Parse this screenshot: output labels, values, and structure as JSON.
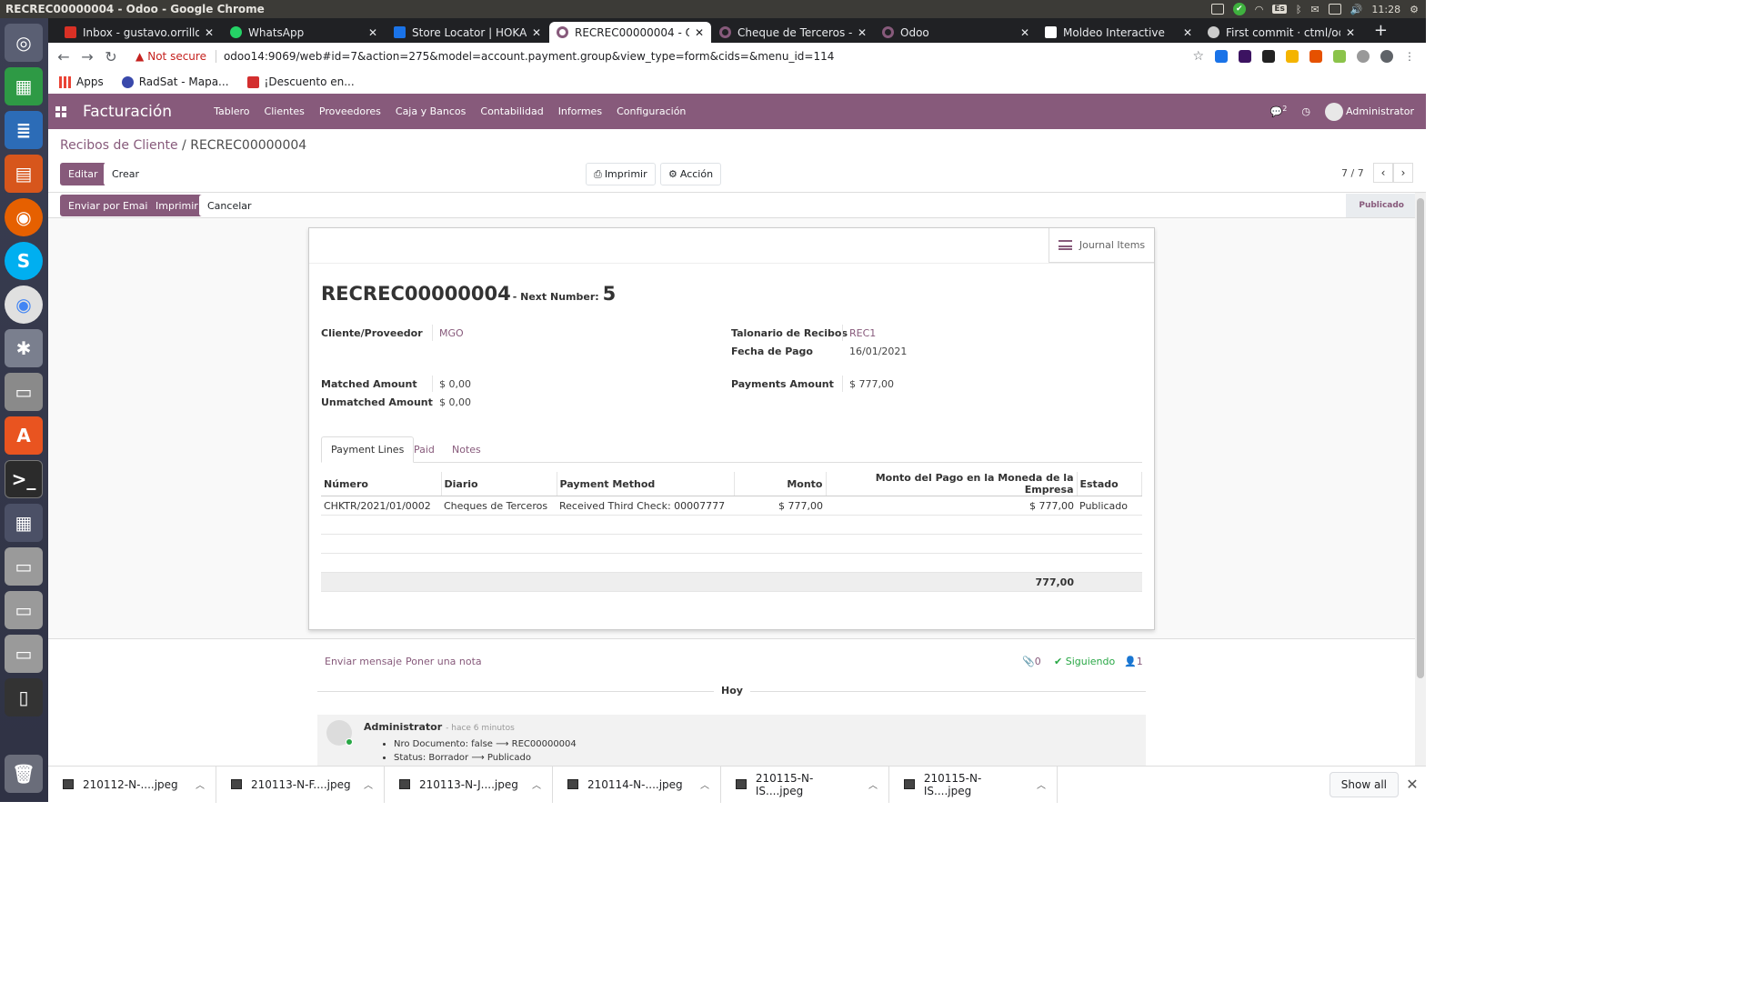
{
  "window_title": "RECREC00000004 - Odoo - Google Chrome",
  "system": {
    "lang": "Es",
    "time": "11:28"
  },
  "tabs": [
    {
      "label": "Inbox - gustavo.orrillo@",
      "icon_color": "#d93025"
    },
    {
      "label": "WhatsApp",
      "icon_color": "#25d366"
    },
    {
      "label": "Store Locator | HOKA O",
      "icon_color": "#1a73e8"
    },
    {
      "label": "RECREC00000004 - Odoo",
      "icon_color": "#875a7b"
    },
    {
      "label": "Cheque de Terceros - O",
      "icon_color": "#875a7b"
    },
    {
      "label": "Odoo",
      "icon_color": "#875a7b"
    },
    {
      "label": "Moldeo Interactive",
      "icon_color": "#ffffff"
    },
    {
      "label": "First commit · ctml/odo",
      "icon_color": "#cccccc"
    }
  ],
  "address": {
    "warning": "Not secure",
    "url": "odoo14:9069/web#id=7&action=275&model=account.payment.group&view_type=form&cids=&menu_id=114"
  },
  "bookmarks": [
    "Apps",
    "RadSat - Mapa...",
    "¡Descuento en..."
  ],
  "odoo": {
    "app": "Facturación",
    "menu": [
      "Tablero",
      "Clientes",
      "Proveedores",
      "Caja y Bancos",
      "Contabilidad",
      "Informes",
      "Configuración"
    ],
    "chat_count": "2",
    "user": "Administrator"
  },
  "breadcrumb": {
    "parent": "Recibos de Cliente",
    "sep": " / ",
    "current": "RECREC00000004"
  },
  "buttons": {
    "edit": "Editar",
    "create": "Crear",
    "print": "Imprimir",
    "action": "Acción",
    "send_email": "Enviar por Email",
    "print2": "Imprimir",
    "cancel": "Cancelar"
  },
  "pager": "7 / 7",
  "status": "Publicado",
  "form": {
    "journal_items": "Journal Items",
    "name": "RECREC00000004",
    "next_number_label": "- Next Number:",
    "next_number": "5",
    "partner_label": "Cliente/Proveedor",
    "partner": "MGO",
    "receiptbook_label": "Talonario de Recibos",
    "receiptbook": "REC1",
    "date_label": "Fecha de Pago",
    "date": "16/01/2021",
    "matched_label": "Matched Amount",
    "matched": "$ 0,00",
    "unmatched_label": "Unmatched Amount",
    "unmatched": "$ 0,00",
    "payments_label": "Payments Amount",
    "payments": "$ 777,00"
  },
  "form_tabs": [
    "Payment Lines",
    "Paid",
    "Notes"
  ],
  "lines": {
    "headers": [
      "Número",
      "Diario",
      "Payment Method",
      "Monto",
      "Monto del Pago en la Moneda de la Empresa",
      "Estado"
    ],
    "rows": [
      [
        "CHKTR/2021/01/0002",
        "Cheques de Terceros",
        "Received Third Check: 00007777",
        "$ 777,00",
        "$ 777,00",
        "Publicado"
      ]
    ],
    "total": "777,00"
  },
  "chatter": {
    "send_message": "Enviar mensaje",
    "log_note": "Poner una nota",
    "attachments": "0",
    "following": "Siguiendo",
    "followers": "1",
    "day": "Hoy",
    "author": "Administrator",
    "time": "- hace 6 minutos",
    "changes": [
      "Nro Documento: false ⟶ REC00000004",
      "Status: Borrador ⟶ Publicado"
    ]
  },
  "downloads": [
    "210112-N-....jpeg",
    "210113-N-F....jpeg",
    "210113-N-J....jpeg",
    "210114-N-....jpeg",
    "210115-N-IS....jpeg",
    "210115-N-IS....jpeg"
  ],
  "show_all": "Show all"
}
